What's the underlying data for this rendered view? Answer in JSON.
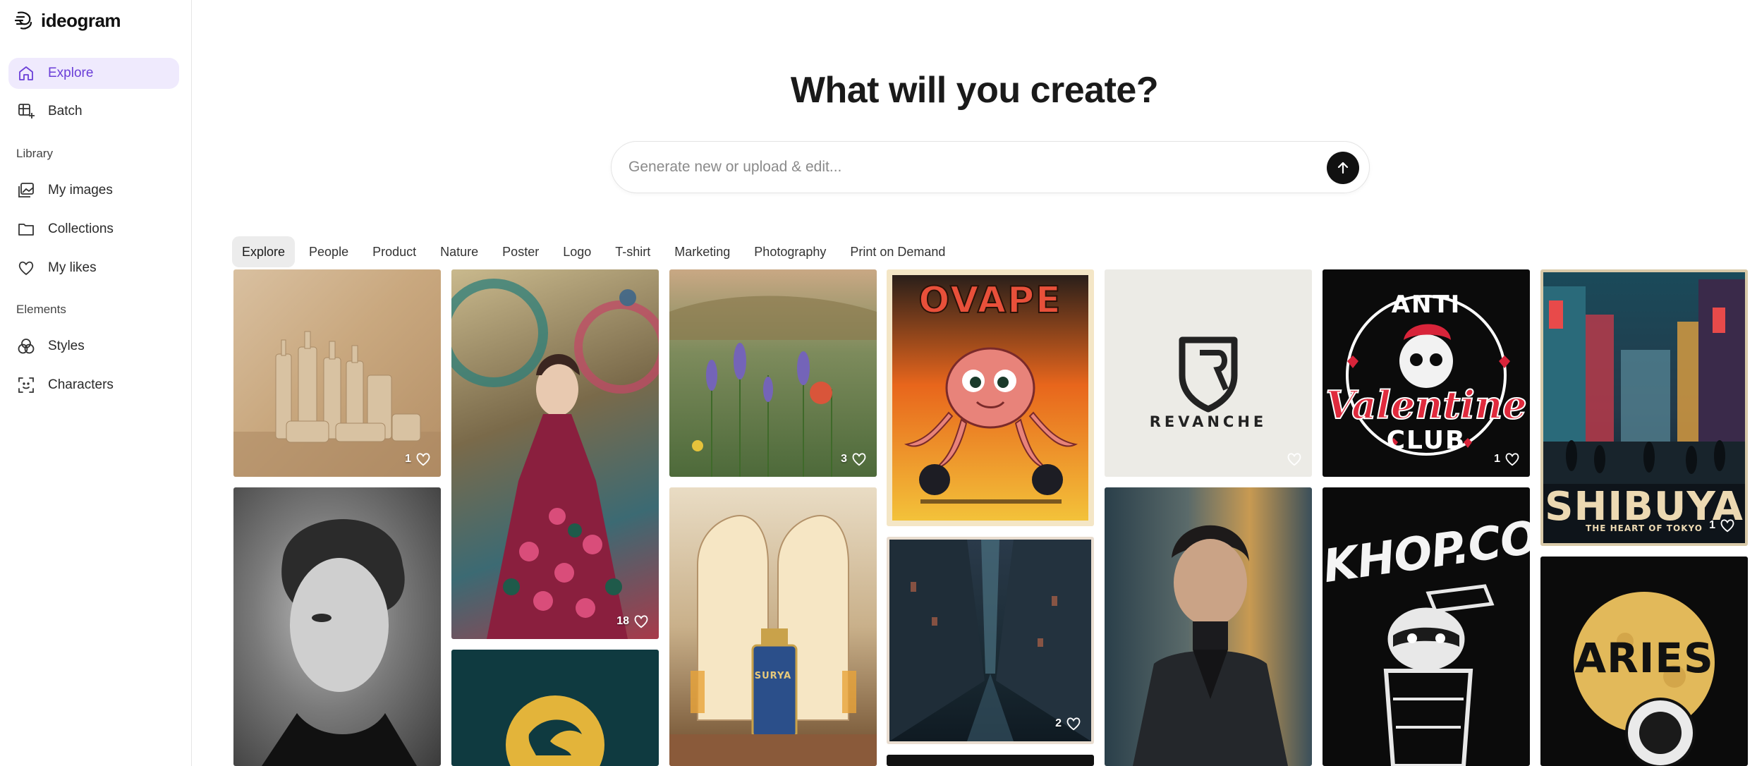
{
  "app": {
    "name": "ideogram"
  },
  "sidebar": {
    "items": [
      {
        "label": "Explore",
        "icon": "home-icon",
        "active": true
      },
      {
        "label": "Batch",
        "icon": "batch-table-icon"
      }
    ],
    "library_label": "Library",
    "library_items": [
      {
        "label": "My images",
        "icon": "images-icon"
      },
      {
        "label": "Collections",
        "icon": "folder-icon"
      },
      {
        "label": "My likes",
        "icon": "heart-icon"
      }
    ],
    "elements_label": "Elements",
    "elements_items": [
      {
        "label": "Styles",
        "icon": "styles-circles-icon"
      },
      {
        "label": "Characters",
        "icon": "character-face-scan-icon"
      }
    ]
  },
  "main": {
    "headline": "What will you create?",
    "prompt_placeholder": "Generate new or upload & edit...",
    "tabs": [
      "Explore",
      "People",
      "Product",
      "Nature",
      "Poster",
      "Logo",
      "T-shirt",
      "Marketing",
      "Photography",
      "Print on Demand"
    ],
    "active_tab": "Explore"
  },
  "gallery": {
    "cards": [
      {
        "name": "cosmetics-bottles",
        "likes": "1"
      },
      {
        "name": "peacock-woman",
        "likes": "18"
      },
      {
        "name": "wildflowers",
        "likes": "3"
      },
      {
        "name": "ovape-poster",
        "title": "OVAPE"
      },
      {
        "name": "revanche-logo",
        "title": "REVANCHE",
        "likes": ""
      },
      {
        "name": "anti-valentine",
        "line1": "ANTI",
        "line2": "Valentine",
        "line3": "CLUB",
        "likes": "1"
      },
      {
        "name": "shibuya-poster",
        "title": "SHIBUYA",
        "subtitle": "THE HEART OF TOKYO",
        "likes": "1"
      },
      {
        "name": "bw-portrait"
      },
      {
        "name": "dragon-logo"
      },
      {
        "name": "surya-perfume",
        "label": "SURYA"
      },
      {
        "name": "city-canyon",
        "likes": "2"
      },
      {
        "name": "man-portrait"
      },
      {
        "name": "khop-raccoon",
        "title": "KHOP.CO"
      },
      {
        "name": "aries-astronaut",
        "title": "ARIES"
      }
    ]
  },
  "colors": {
    "accent": "#6b3fd8",
    "active_bg": "#efeafd"
  }
}
